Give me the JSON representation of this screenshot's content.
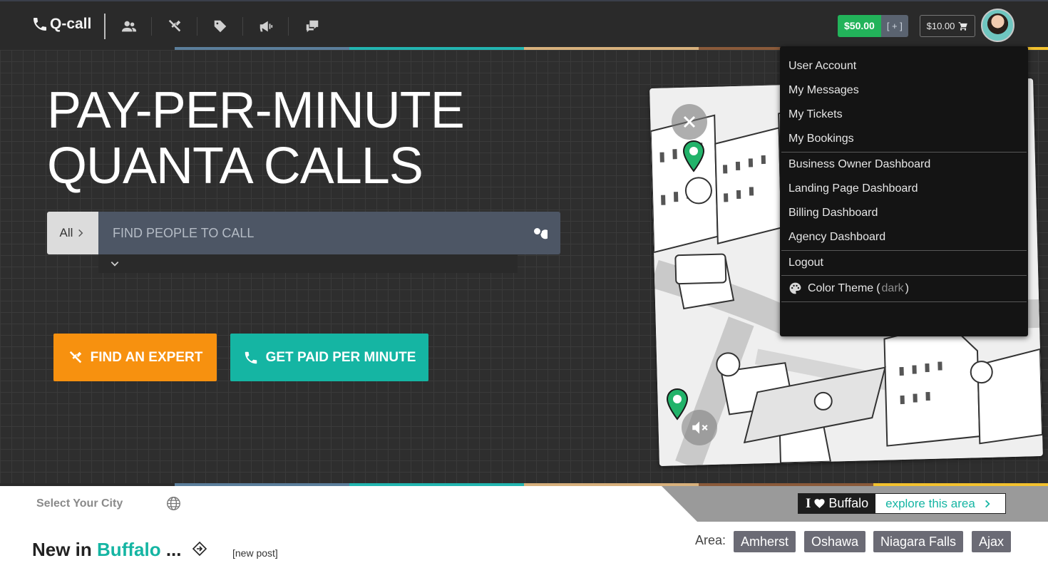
{
  "nav": {
    "brand": "Q-call",
    "icons": [
      "people-icon",
      "expert-icon",
      "tag-icon",
      "megaphone-icon",
      "chat-icon"
    ],
    "wallet_amount": "$50.00",
    "wallet_add": "[ + ]",
    "cart_amount": "$10.00"
  },
  "hero": {
    "title_line1": "PAY-PER-MINUTE",
    "title_line2": "QUANTA CALLS",
    "search": {
      "category": "All",
      "placeholder": "FIND PEOPLE TO CALL"
    },
    "buttons": {
      "expert": "FIND AN EXPERT",
      "paid": "GET PAID PER MINUTE"
    }
  },
  "menu": {
    "group1": [
      "User Account",
      "My Messages",
      "My Tickets",
      "My Bookings"
    ],
    "group2": [
      "Business Owner Dashboard",
      "Landing Page Dashboard",
      "Billing Dashboard",
      "Agency Dashboard"
    ],
    "logout": "Logout",
    "theme_label": "Color Theme",
    "theme_open": "(",
    "theme_value": "dark",
    "theme_close": ")"
  },
  "footer": {
    "select_city": "Select Your City",
    "ilove_prefix": "I",
    "ilove_city": "Buffalo",
    "explore": "explore this area",
    "new_in": "New in",
    "new_in_city": "Buffalo",
    "new_in_suffix": "...",
    "new_post": "[new post]",
    "area_label": "Area:",
    "areas": [
      "Amherst",
      "Oshawa",
      "Niagara Falls",
      "Ajax"
    ]
  },
  "colors": {
    "orange": "#f7910f",
    "teal": "#15b5a3",
    "green": "#22b35a",
    "accent_stripes": [
      "#2a2a2a",
      "#5b7e9b",
      "#22b5b0",
      "#d7b07c",
      "#8a5a3a",
      "#f2c12e"
    ]
  }
}
